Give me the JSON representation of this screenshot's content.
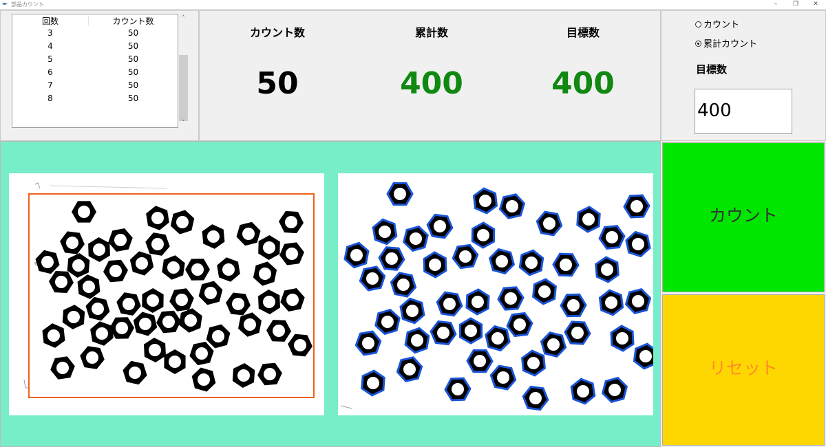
{
  "window": {
    "title": "部品カウント",
    "controls": {
      "minimize": "–",
      "restore": "❐",
      "close": "✕"
    }
  },
  "history": {
    "columns": [
      "回数",
      "カウント数"
    ],
    "rows": [
      [
        "3",
        "50"
      ],
      [
        "4",
        "50"
      ],
      [
        "5",
        "50"
      ],
      [
        "6",
        "50"
      ],
      [
        "7",
        "50"
      ],
      [
        "8",
        "50"
      ]
    ]
  },
  "stats": {
    "count_label": "カウント数",
    "count_value": "50",
    "total_label": "累計数",
    "total_value": "400",
    "target_label": "目標数",
    "target_value": "400"
  },
  "settings": {
    "mode_options": [
      "カウント",
      "累計カウント"
    ],
    "selected_mode": "累計カウント",
    "target_label": "目標数",
    "target_input_value": "400"
  },
  "buttons": {
    "count": "カウント",
    "reset": "リセット"
  },
  "colors": {
    "camera_background": "#77edc9",
    "count_button": "#00e600",
    "reset_button": "#ffd700",
    "reset_text": "#ff8a2a",
    "stat_green": "#118811",
    "roi_box": "#f06018",
    "detect_green": "#22cc22",
    "detect_blue": "#1a55d8"
  },
  "images": {
    "left": "camera-input-nuts",
    "right": "detection-result-nuts"
  }
}
